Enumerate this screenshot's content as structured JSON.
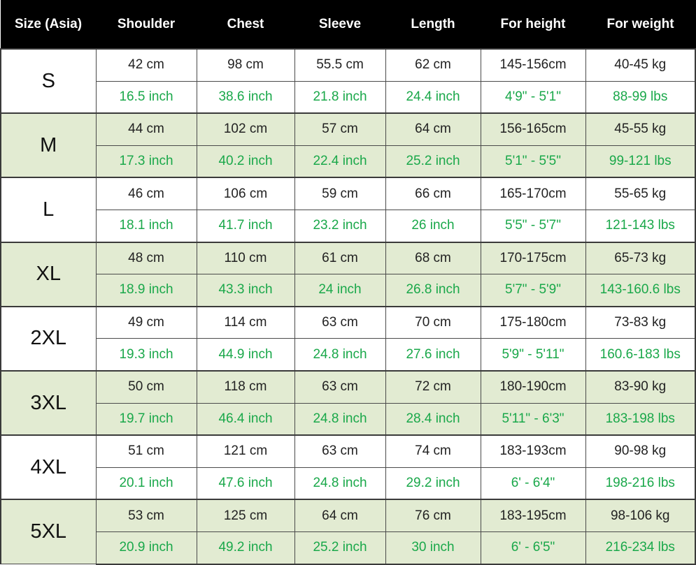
{
  "colors": {
    "header_bg": "#000000",
    "header_text": "#ffffff",
    "metric_text": "#222222",
    "imperial_text": "#1aa84a",
    "shaded_row_bg": "#e2ebd2",
    "plain_row_bg": "#ffffff"
  },
  "headers": [
    "Size (Asia)",
    "Shoulder",
    "Chest",
    "Sleeve",
    "Length",
    "For height",
    "For weight"
  ],
  "rows": [
    {
      "size": "S",
      "metric": [
        "42 cm",
        "98 cm",
        "55.5 cm",
        "62 cm",
        "145-156cm",
        "40-45 kg"
      ],
      "imperial": [
        "16.5 inch",
        "38.6 inch",
        "21.8 inch",
        "24.4 inch",
        "4'9\" - 5'1\"",
        "88-99 lbs"
      ]
    },
    {
      "size": "M",
      "metric": [
        "44 cm",
        "102 cm",
        "57 cm",
        "64 cm",
        "156-165cm",
        "45-55 kg"
      ],
      "imperial": [
        "17.3 inch",
        "40.2 inch",
        "22.4 inch",
        "25.2 inch",
        "5'1\" - 5'5\"",
        "99-121 lbs"
      ]
    },
    {
      "size": "L",
      "metric": [
        "46 cm",
        "106 cm",
        "59 cm",
        "66 cm",
        "165-170cm",
        "55-65 kg"
      ],
      "imperial": [
        "18.1 inch",
        "41.7 inch",
        "23.2 inch",
        "26 inch",
        "5'5\" - 5'7\"",
        "121-143 lbs"
      ]
    },
    {
      "size": "XL",
      "metric": [
        "48 cm",
        "110 cm",
        "61 cm",
        "68 cm",
        "170-175cm",
        "65-73 kg"
      ],
      "imperial": [
        "18.9 inch",
        "43.3 inch",
        "24 inch",
        "26.8 inch",
        "5'7\" - 5'9\"",
        "143-160.6 lbs"
      ]
    },
    {
      "size": "2XL",
      "metric": [
        "49 cm",
        "114 cm",
        "63 cm",
        "70 cm",
        "175-180cm",
        "73-83 kg"
      ],
      "imperial": [
        "19.3 inch",
        "44.9 inch",
        "24.8 inch",
        "27.6 inch",
        "5'9\" - 5'11\"",
        "160.6-183 lbs"
      ]
    },
    {
      "size": "3XL",
      "metric": [
        "50 cm",
        "118 cm",
        "63 cm",
        "72 cm",
        "180-190cm",
        "83-90 kg"
      ],
      "imperial": [
        "19.7 inch",
        "46.4 inch",
        "24.8 inch",
        "28.4 inch",
        "5'11\" - 6'3\"",
        "183-198 lbs"
      ]
    },
    {
      "size": "4XL",
      "metric": [
        "51 cm",
        "121 cm",
        "63 cm",
        "74 cm",
        "183-193cm",
        "90-98 kg"
      ],
      "imperial": [
        "20.1 inch",
        "47.6 inch",
        "24.8 inch",
        "29.2 inch",
        "6' - 6'4\"",
        "198-216 lbs"
      ]
    },
    {
      "size": "5XL",
      "metric": [
        "53 cm",
        "125 cm",
        "64 cm",
        "76 cm",
        "183-195cm",
        "98-106 kg"
      ],
      "imperial": [
        "20.9 inch",
        "49.2 inch",
        "25.2 inch",
        "30 inch",
        "6' - 6'5\"",
        "216-234 lbs"
      ]
    }
  ]
}
